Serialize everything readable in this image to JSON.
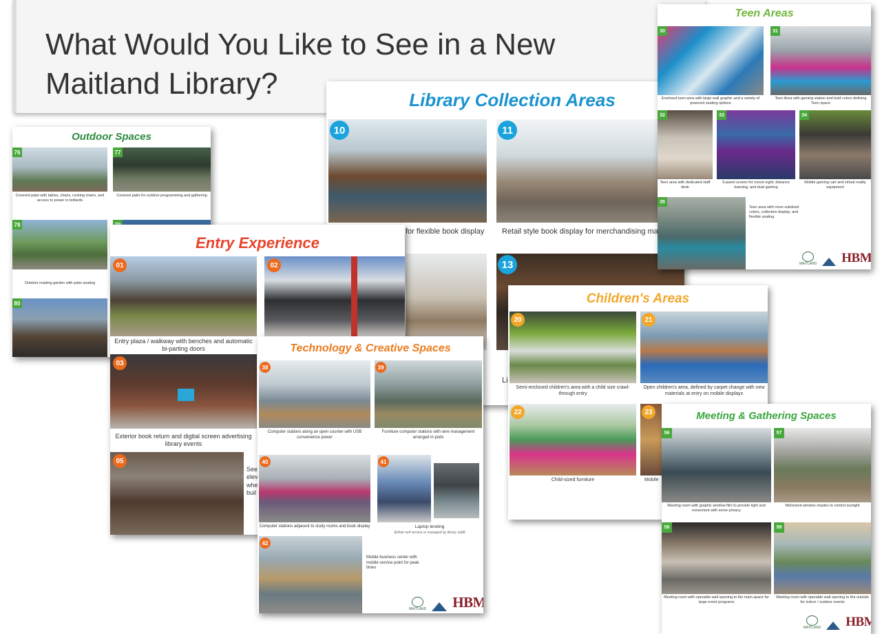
{
  "colors": {
    "orange_badge": "#ec6a1e",
    "blue_badge": "#1aa3dc",
    "green_badge": "#49a83b",
    "entry_title": "#e8432b",
    "collection_title": "#1a93d0",
    "tech_title": "#ec7a1c",
    "children_title": "#f2a72a",
    "outdoor_title": "#2e8a3e",
    "teen_title": "#6fb53a",
    "meeting_title": "#3aa53f",
    "hbm": "#8a1f2a",
    "maitland": "#3a6b46"
  },
  "intro": {
    "title_line1": "What Would You Like to See in a New",
    "title_line2": "Maitland Library?"
  },
  "outdoor": {
    "title": "Outdoor Spaces",
    "items": [
      {
        "num": "76",
        "caption": "Covered patio with tables, chairs, rocking chairs, and access to power in bollards"
      },
      {
        "num": "77",
        "caption": "Covered patio for outdoor programming and gathering"
      },
      {
        "num": "78",
        "caption": "Outdoor reading garden with patio seating"
      },
      {
        "num": "79",
        "caption": ""
      },
      {
        "num": "80",
        "caption": ""
      }
    ]
  },
  "collection": {
    "title": "Library Collection Areas",
    "items": [
      {
        "num": "10",
        "caption": "for flexible book display"
      },
      {
        "num": "11",
        "caption": "Retail style book display for merchandising ma"
      },
      {
        "num": "13",
        "caption": ""
      }
    ],
    "partial_caption": "Li"
  },
  "entry": {
    "title": "Entry Experience",
    "items": [
      {
        "num": "01",
        "caption": "Entry plaza / walkway with benches and automatic bi-parting doors"
      },
      {
        "num": "02",
        "caption": ""
      },
      {
        "num": "03",
        "caption": "Exterior book return and digital screen advertising library events"
      },
      {
        "num": "05",
        "caption": "See\nelev\nwhe\nbuil"
      }
    ]
  },
  "tech": {
    "title": "Technology & Creative Spaces",
    "items": [
      {
        "num": "38",
        "caption": "Computer stations along an open counter with USB convenience power"
      },
      {
        "num": "39",
        "caption": "Furniture computer stations with wire management arranged in pods"
      },
      {
        "num": "40",
        "caption": "Computer stations adjacent to study rooms and book display"
      },
      {
        "num": "41",
        "caption": "Laptop lending",
        "subcaption": "(Either self service or managed by library staff)"
      },
      {
        "num": "42",
        "caption": "Mobile business center with mobile service point for peak times"
      }
    ],
    "logo": {
      "maitland": "MAITLAND",
      "hbm": "HBM",
      "hbm_sub": "ARCHITECTURE"
    }
  },
  "teen": {
    "title": "Teen Areas",
    "items": [
      {
        "num": "30",
        "caption": "Enclosed teen area with large wall graphic and a variety of powered seating options"
      },
      {
        "num": "31",
        "caption": "Teen Area with gaming station and bold colors defining Teen space"
      },
      {
        "num": "32",
        "caption": "Teen area with dedicated staff desk"
      },
      {
        "num": "33",
        "caption": "9-panel screen for movie night, distance learning, and dual gaming"
      },
      {
        "num": "34",
        "caption": "Mobile gaming cart and virtual reality equipment"
      },
      {
        "num": "35",
        "caption": "Teen area with more subdued colors, collection display, and flexible seating"
      }
    ],
    "logo": {
      "maitland": "MAITLAND",
      "hbm": "HBM",
      "hbm_sub": "ARCHITECTURE"
    }
  },
  "children": {
    "title": "Children's Areas",
    "items": [
      {
        "num": "20",
        "caption": "Semi-enclosed children's area with a child size crawl-through entry"
      },
      {
        "num": "21",
        "caption": "Open children's area, defined by carpet change with new materials at entry on mobile displays"
      },
      {
        "num": "22",
        "caption": "Child-sized furniture"
      },
      {
        "num": "23",
        "caption": "Mobile"
      }
    ]
  },
  "meeting": {
    "title": "Meeting & Gathering Spaces",
    "items": [
      {
        "num": "56",
        "caption": "Meeting room with graphic window film to provide light and movement with some privacy"
      },
      {
        "num": "57",
        "caption": "Motorized window shades to control sunlight"
      },
      {
        "num": "58",
        "caption": "Meeting room with operable wall opening to the main space for large event programs"
      },
      {
        "num": "59",
        "caption": "Meeting room with operable wall opening to the outside for indoor / outdoor events"
      }
    ],
    "logo": {
      "maitland": "MAITLAND",
      "hbm": "HBM",
      "hbm_sub": "ARCHITECTURE"
    }
  }
}
